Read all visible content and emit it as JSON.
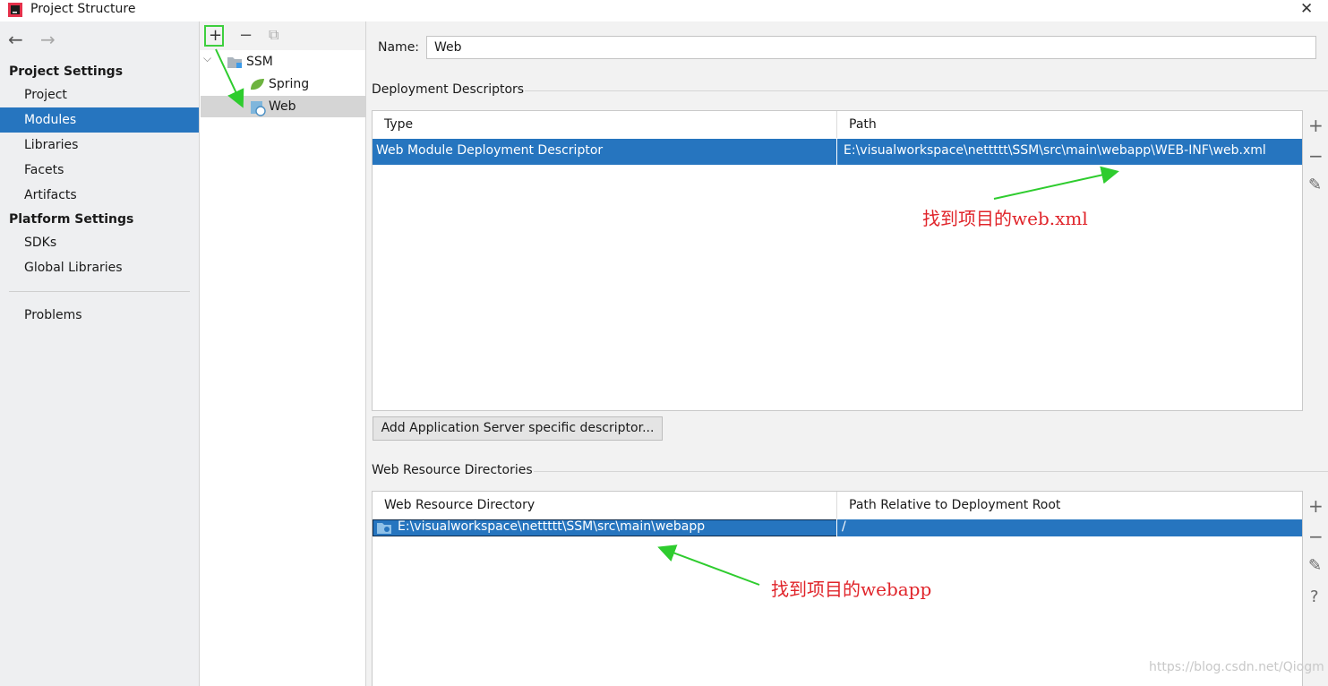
{
  "window": {
    "title": "Project Structure"
  },
  "sidebar": {
    "nav": {
      "back": "←",
      "forward": "→"
    },
    "project_settings_title": "Project Settings",
    "project_settings_items": [
      "Project",
      "Modules",
      "Libraries",
      "Facets",
      "Artifacts"
    ],
    "selected_item": "Modules",
    "platform_settings_title": "Platform Settings",
    "platform_settings_items": [
      "SDKs",
      "Global Libraries"
    ],
    "problems": "Problems"
  },
  "tree": {
    "toolbar": {
      "add": "+",
      "remove": "−",
      "copy": "⧉"
    },
    "root": "SSM",
    "children": [
      "Spring",
      "Web"
    ],
    "selected": "Web"
  },
  "detail": {
    "name_label": "Name:",
    "name_value": "Web",
    "deployment": {
      "title": "Deployment Descriptors",
      "columns": [
        "Type",
        "Path"
      ],
      "rows": [
        {
          "type": "Web Module Deployment Descriptor",
          "path": "E:\\visualworkspace\\nettttt\\SSM\\src\\main\\webapp\\WEB-INF\\web.xml"
        }
      ],
      "add_server_button": "Add Application Server specific descriptor..."
    },
    "web_resources": {
      "title": "Web Resource Directories",
      "columns": [
        "Web Resource Directory",
        "Path Relative to Deployment Root"
      ],
      "rows": [
        {
          "directory": "E:\\visualworkspace\\nettttt\\SSM\\src\\main\\webapp",
          "relative": "/"
        }
      ]
    },
    "side_tools": {
      "add": "+",
      "remove": "−",
      "edit": "✎",
      "help": "?"
    }
  },
  "annotations": {
    "webxml_note": "找到项目的web.xml",
    "webapp_note": "找到项目的webapp",
    "arrow_color": "#2ecc2e",
    "text_color": "#e0242a"
  },
  "watermark": "https://blog.csdn.net/Qiogm"
}
